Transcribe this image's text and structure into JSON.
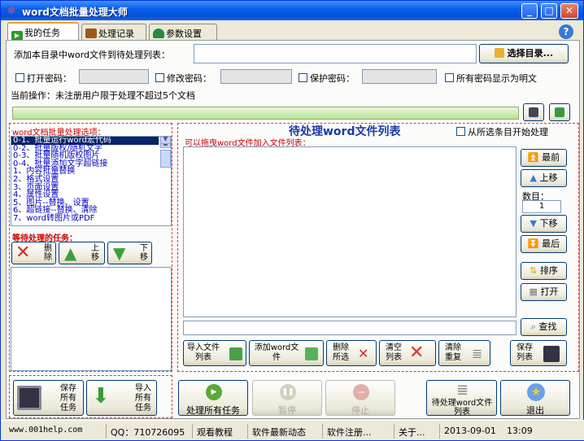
{
  "window": {
    "title": "word文档批量处理大师",
    "min": "_",
    "max": "□",
    "close": "✕"
  },
  "tabs": [
    {
      "label": "我的任务"
    },
    {
      "label": "处理记录"
    },
    {
      "label": "参数设置"
    }
  ],
  "top": {
    "add_dir_label": "添加本目录中word文件到待处理列表：",
    "dir_value": "",
    "select_dir_btn": "选择目录...",
    "open_pwd_label": "打开密码：",
    "modify_pwd_label": "修改密码：",
    "protect_pwd_label": "保护密码：",
    "show_plain_label": "所有密码显示为明文",
    "current_op": "当前操作：未注册用户限于处理不超过5个文档"
  },
  "options": {
    "title": "word文档批量处理选项：",
    "items": [
      "0-1、批量运行word宏代码",
      "0-2、批量版权/随机文字",
      "0-3、批量随机版权图片",
      "0-4、批量添加文字超链接",
      "1、内容批量替换",
      "2、格式设置",
      "3、页面设置",
      "4、属性设置",
      "5、图片--替换、设置",
      "6、超链接--替换、清除",
      "7、word转图片或PDF"
    ]
  },
  "pending": {
    "title": "等待处理的任务：",
    "del_btn": "删除",
    "up_btn": "上移",
    "down_btn": "下移",
    "save_tasks_btn": "保存所有任务",
    "import_tasks_btn": "导入所有任务"
  },
  "filelist": {
    "title": "待处理word文件列表",
    "from_selected_label": "从所选条目开始处理",
    "drag_hint": "可以拖曳word文件加入文件列表：",
    "top_btn": "最前",
    "up_btn": "上移",
    "count_label": "数目：",
    "count_value": "1",
    "down_btn": "下移",
    "bottom_btn": "最后",
    "sort_btn": "排序",
    "open_btn": "打开",
    "find_btn": "查找",
    "import_list_btn": "导入文件列表",
    "add_word_btn": "添加word文件",
    "delete_sel_btn": "删除所选",
    "clear_list_btn": "清空列表",
    "clear_dup_btn": "清除重复",
    "save_list_btn": "保存列表"
  },
  "actions": {
    "process_all": "处理所有任务",
    "pause": "暂停",
    "stop": "停止",
    "pending_list": "待处理word文件列表",
    "exit": "退出"
  },
  "status": {
    "site": "www.001help.com",
    "qq": "QQ：710726095",
    "tutorial": "观看教程",
    "news": "软件最新动态",
    "register": "软件注册...",
    "about": "关于...",
    "date": "2013-09-01",
    "time": "13:09"
  }
}
